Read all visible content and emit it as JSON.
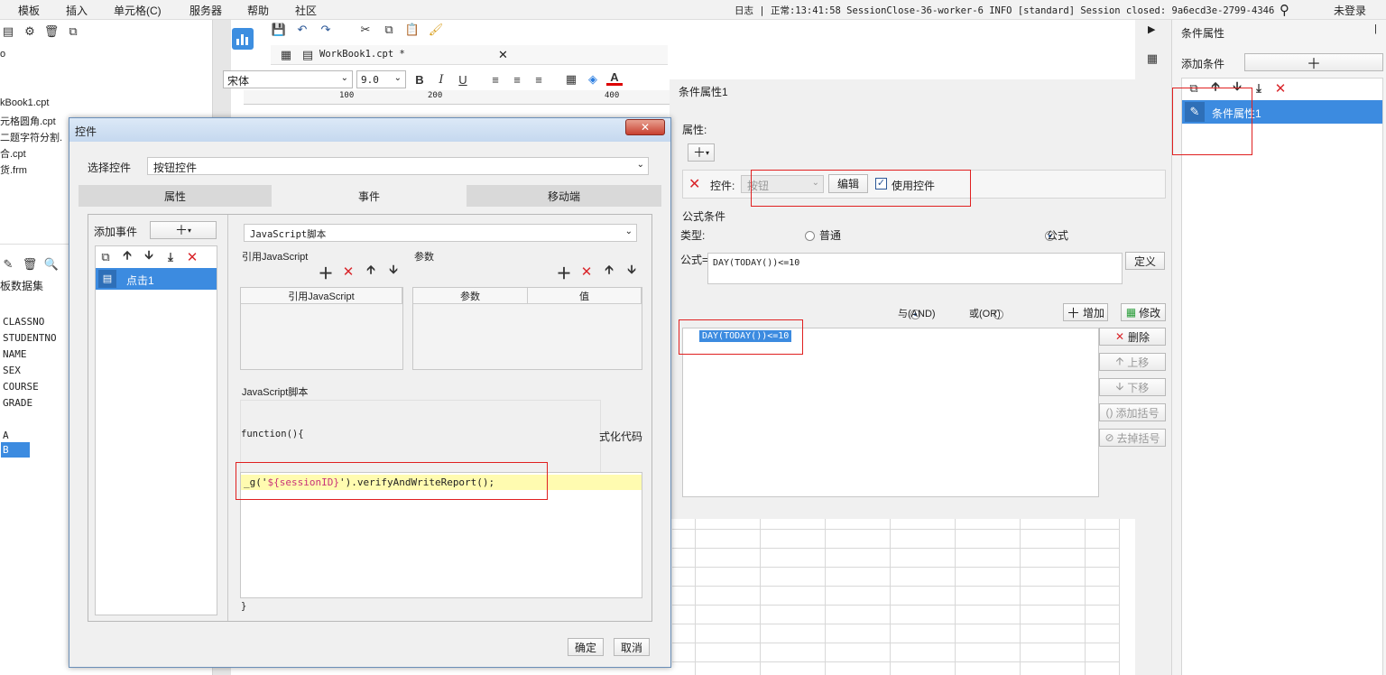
{
  "menubar": {
    "items": [
      "模板",
      "插入",
      "单元格(C)",
      "服务器",
      "帮助",
      "社区"
    ],
    "log_text": "日志 | 正常:13:41:58 SessionClose-36-worker-6 INFO [standard] Session closed: 9a6ecd3e-2799-4346-...",
    "login": "未登录"
  },
  "toolbar": {
    "doc_tab": "WorkBook1.cpt *",
    "font_name": "宋体",
    "font_size": "9.0",
    "ruler_marks": [
      "100",
      "200",
      "400"
    ]
  },
  "left_panel": {
    "top_label": "o",
    "files": [
      "kBook1.cpt",
      "元格圆角.cpt",
      "二题字符分割.",
      "合.cpt",
      "货.frm"
    ],
    "dataset_title": "板数据集",
    "fields": [
      "CLASSNO",
      "STUDENTNO",
      "NAME",
      "SEX",
      "COURSE",
      "GRADE"
    ],
    "extra_items": [
      "A",
      "B"
    ]
  },
  "dialog": {
    "title": "控件",
    "select_label": "选择控件",
    "select_value": "按钮控件",
    "tabs": [
      "属性",
      "事件",
      "移动端"
    ],
    "add_event_label": "添加事件",
    "event_items": [
      "点击1"
    ],
    "script_type": "JavaScript脚本",
    "ref_js_title": "引用JavaScript",
    "params_title": "参数",
    "ref_js_col": "引用JavaScript",
    "param_cols": [
      "参数",
      "值"
    ],
    "js_script_title": "JavaScript脚本",
    "func_open": "function(){",
    "format_code": "式化代码",
    "code_prefix": "_g('",
    "code_var": "${sessionID}",
    "code_suffix": "').verifyAndWriteReport();",
    "func_close": "}",
    "ok_label": "确定",
    "cancel_label": "取消"
  },
  "condition": {
    "title": "条件属性1",
    "attr_label": "属性:",
    "widget_label": "控件:",
    "widget_value": "按钮",
    "edit_label": "编辑",
    "use_widget_label": "使用控件",
    "formula_section": "公式条件",
    "type_label": "类型:",
    "type_normal": "普通",
    "type_formula": "公式",
    "formula_label": "公式=",
    "formula_value": "DAY(TODAY())<=10",
    "define_label": "定义",
    "and_label": "与(AND)",
    "or_label": "或(OR)",
    "add_label": "增加",
    "modify_label": "修改",
    "list_items": [
      "DAY(TODAY())<=10"
    ],
    "delete_label": "删除",
    "up_label": "上移",
    "down_label": "下移",
    "add_bracket_label": "添加括号",
    "remove_bracket_label": "去掉括号"
  },
  "right_panel": {
    "title": "条件属性",
    "add_condition_label": "添加条件",
    "items": [
      "条件属性1"
    ]
  },
  "colors": {
    "accent": "#3d8ee0",
    "selection": "#3c8be0",
    "highlight_line": "#fffbb0",
    "annotation": "#e02020"
  }
}
